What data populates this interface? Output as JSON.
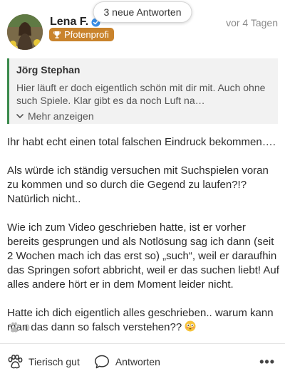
{
  "banner": {
    "label": "3 neue Antworten"
  },
  "post": {
    "author": "Lena F.",
    "badge": "Pfotenprofi",
    "timestamp": "vor 4 Tagen"
  },
  "quote": {
    "author": "Jörg Stephan",
    "text": "Hier läuft er doch eigentlich schön mit dir mit. Auch ohne such Spiele. Klar gibt es da noch Luft na…",
    "more_label": "Mehr anzeigen"
  },
  "content": {
    "paragraphs": [
      "Ihr habt echt einen total falschen Eindruck bekommen….",
      "Als würde ich ständig versuchen mit Suchspielen voran zu kommen und so durch die Gegend zu laufen?!? Natürlich nicht..",
      "Wie ich zum Video geschrieben hatte, ist er vorher bereits gesprungen und als Notlösung sag ich dann (seit 2 Wochen mach ich das erst so) „such“, weil er daraufhin das Springen sofort abbricht, weil er das suchen liebt! Auf alles andere hört er in dem Moment leider nicht.",
      "Hatte ich dich eigentlich alles geschrieben.. warum kann man das dann so falsch verstehen??"
    ]
  },
  "reactions": {
    "count": "0"
  },
  "actions": {
    "like_label": "Tierisch gut",
    "reply_label": "Antworten",
    "more_label": "•••"
  },
  "colors": {
    "accent_green": "#3b8a4c",
    "badge_orange": "#c9832c",
    "verified_blue": "#3a8ee6"
  },
  "icons": [
    "verified-icon",
    "trophy-icon",
    "chevron-down-icon",
    "flushed-face-emoji",
    "paw-icon",
    "speech-bubble-icon",
    "more-dots-icon"
  ]
}
